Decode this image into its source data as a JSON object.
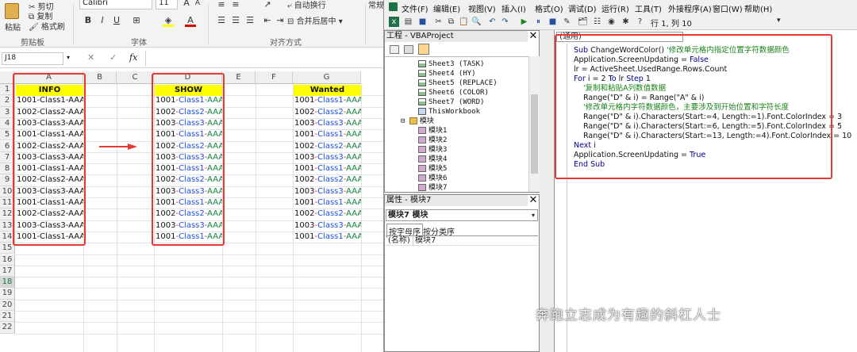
{
  "excel": {
    "ribbon": {
      "paste_label": "粘贴",
      "cut_label": "剪切",
      "copy_label": "复制",
      "format_painter_label": "格式刷",
      "clipboard_group": "剪贴板",
      "font_name": "Calibri",
      "font_size": "11",
      "bold": "B",
      "italic": "I",
      "underline": "U",
      "font_group": "字体",
      "wrap_text": "自动换行",
      "merge_center": "合并后居中",
      "alignment_group": "对齐方式",
      "number_format_partial": "常规"
    },
    "formula_bar": {
      "name_box": "J18",
      "fx": "fx"
    },
    "columns": [
      "A",
      "B",
      "C",
      "D",
      "E",
      "F",
      "G"
    ],
    "rows": [
      "1",
      "2",
      "3",
      "4",
      "5",
      "6",
      "7",
      "8",
      "9",
      "10",
      "11",
      "12",
      "13",
      "14",
      "15",
      "16",
      "17",
      "18",
      "19",
      "20",
      "21",
      "22"
    ],
    "headers": {
      "info": "INFO",
      "show": "SHOW",
      "wanted": "Wanted"
    },
    "data": [
      {
        "info": "1001-Class1-AAA1",
        "p1": "1001",
        "p2": "-",
        "p3": "Class1",
        "p4": "-",
        "p5": "AAA1"
      },
      {
        "info": "1002-Class2-AAA2",
        "p1": "1002",
        "p2": "-",
        "p3": "Class2",
        "p4": "-",
        "p5": "AAA2"
      },
      {
        "info": "1003-Class3-AAA3",
        "p1": "1003",
        "p2": "-",
        "p3": "Class3",
        "p4": "-",
        "p5": "AAA3"
      },
      {
        "info": "1001-Class1-AAA2",
        "p1": "1001",
        "p2": "-",
        "p3": "Class1",
        "p4": "-",
        "p5": "AAA2"
      },
      {
        "info": "1002-Class2-AAA3",
        "p1": "1002",
        "p2": "-",
        "p3": "Class2",
        "p4": "-",
        "p5": "AAA3"
      },
      {
        "info": "1003-Class3-AAA4",
        "p1": "1003",
        "p2": "-",
        "p3": "Class3",
        "p4": "-",
        "p5": "AAA4"
      },
      {
        "info": "1001-Class1-AAA3",
        "p1": "1001",
        "p2": "-",
        "p3": "Class1",
        "p4": "-",
        "p5": "AAA3"
      },
      {
        "info": "1002-Class2-AAA4",
        "p1": "1002",
        "p2": "-",
        "p3": "Class2",
        "p4": "-",
        "p5": "AAA4"
      },
      {
        "info": "1003-Class3-AAA5",
        "p1": "1003",
        "p2": "-",
        "p3": "Class3",
        "p4": "-",
        "p5": "AAA5"
      },
      {
        "info": "1001-Class1-AAA4",
        "p1": "1001",
        "p2": "-",
        "p3": "Class1",
        "p4": "-",
        "p5": "AAA4"
      },
      {
        "info": "1002-Class2-AAA5",
        "p1": "1002",
        "p2": "-",
        "p3": "Class2",
        "p4": "-",
        "p5": "AAA5"
      },
      {
        "info": "1003-Class3-AAA6",
        "p1": "1003",
        "p2": "-",
        "p3": "Class3",
        "p4": "-",
        "p5": "AAA6"
      },
      {
        "info": "1001-Class1-AAA5",
        "p1": "1001",
        "p2": "-",
        "p3": "Class1",
        "p4": "-",
        "p5": "AAA5"
      }
    ],
    "colors": {
      "red_box": "#e53935",
      "header_fill": "#ffff00",
      "blue": "#1f4fd8",
      "green": "#12833b",
      "red": "#d32f2f"
    }
  },
  "vbe": {
    "menus": [
      "文件(F)",
      "编辑(E)",
      "视图(V)",
      "插入(I)",
      "格式(O)",
      "调试(D)",
      "运行(R)",
      "工具(T)",
      "外接程序(A)",
      "窗口(W)",
      "帮助(H)"
    ],
    "cursor_pos": "行 1, 列 10",
    "project_title": "工程 - VBAProject",
    "tree": [
      {
        "label": "Sheet3 (TASK)",
        "kind": "sheet"
      },
      {
        "label": "Sheet4 (HY)",
        "kind": "sheet"
      },
      {
        "label": "Sheet5 (REPLACE)",
        "kind": "sheet"
      },
      {
        "label": "Sheet6 (COLOR)",
        "kind": "sheet"
      },
      {
        "label": "Sheet7 (WORD)",
        "kind": "sheet"
      },
      {
        "label": "ThisWorkbook",
        "kind": "wb"
      },
      {
        "label": "模块",
        "kind": "folder"
      },
      {
        "label": "模块1",
        "kind": "mod"
      },
      {
        "label": "模块2",
        "kind": "mod"
      },
      {
        "label": "模块3",
        "kind": "mod"
      },
      {
        "label": "模块4",
        "kind": "mod"
      },
      {
        "label": "模块5",
        "kind": "mod"
      },
      {
        "label": "模块6",
        "kind": "mod"
      },
      {
        "label": "模块7",
        "kind": "mod"
      }
    ],
    "props_title": "属性 - 模块7",
    "props_object": "模块7 模块",
    "props_tabs": [
      "按字母序",
      "按分类序"
    ],
    "props_name_key": "(名称)",
    "props_name_value": "模块7",
    "code_combo": "(通用)",
    "code_lines": [
      {
        "parts": [
          {
            "t": "Sub ",
            "c": "kw"
          },
          {
            "t": "ChangeWordColor() ",
            "c": "tx"
          },
          {
            "t": "'修改单元格内指定位置字符数据颜色",
            "c": "cm"
          }
        ],
        "indent": 0
      },
      {
        "parts": [
          {
            "t": "Application.ScreenUpdating = ",
            "c": "tx"
          },
          {
            "t": "False",
            "c": "kw"
          }
        ],
        "indent": 0
      },
      {
        "parts": [
          {
            "t": "lr = ActiveSheet.UsedRange.Rows.Count",
            "c": "tx"
          }
        ],
        "indent": 0
      },
      {
        "parts": [
          {
            "t": "For ",
            "c": "kw"
          },
          {
            "t": "i = 2 ",
            "c": "tx"
          },
          {
            "t": "To ",
            "c": "kw"
          },
          {
            "t": "lr ",
            "c": "tx"
          },
          {
            "t": "Step ",
            "c": "kw"
          },
          {
            "t": "1",
            "c": "tx"
          }
        ],
        "indent": 0
      },
      {
        "parts": [
          {
            "t": "'复制和粘贴A列数值数据",
            "c": "cm"
          }
        ],
        "indent": 1
      },
      {
        "parts": [
          {
            "t": "Range(\"D\" & i) = Range(\"A\" & i)",
            "c": "tx"
          }
        ],
        "indent": 1
      },
      {
        "parts": [
          {
            "t": "'修改单元格内字符数据颜色，主要涉及到开始位置和字符长度",
            "c": "cm"
          }
        ],
        "indent": 1
      },
      {
        "parts": [
          {
            "t": "Range(\"D\" & i).Characters(Start:=4, Length:=1).Font.ColorIndex = 3",
            "c": "tx"
          }
        ],
        "indent": 1
      },
      {
        "parts": [
          {
            "t": "Range(\"D\" & i).Characters(Start:=6, Length:=5).Font.ColorIndex = 5",
            "c": "tx"
          }
        ],
        "indent": 1
      },
      {
        "parts": [
          {
            "t": "Range(\"D\" & i).Characters(Start:=13, Length:=4).Font.ColorIndex = 10",
            "c": "tx"
          }
        ],
        "indent": 1
      },
      {
        "parts": [
          {
            "t": "Next ",
            "c": "kw"
          },
          {
            "t": "i",
            "c": "tx"
          }
        ],
        "indent": 0
      },
      {
        "parts": [
          {
            "t": "Application.ScreenUpdating = ",
            "c": "tx"
          },
          {
            "t": "True",
            "c": "kw"
          }
        ],
        "indent": 0
      },
      {
        "parts": [
          {
            "t": "End Sub",
            "c": "kw"
          }
        ],
        "indent": 0
      }
    ]
  },
  "watermark": "奔跑立志成为有趣的斜杠人士"
}
